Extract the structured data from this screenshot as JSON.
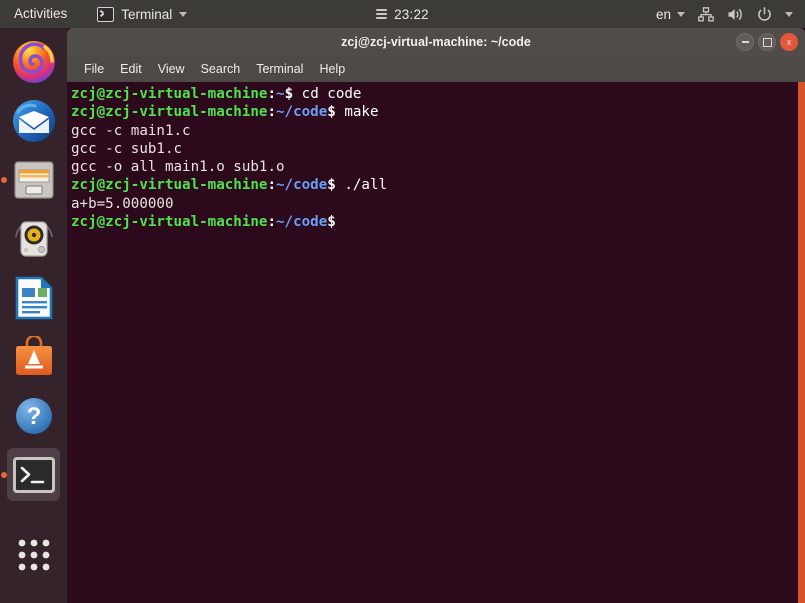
{
  "topbar": {
    "activities": "Activities",
    "app_name": "Terminal",
    "app_icon": "terminal-icon",
    "clock": "23:22",
    "clock_icon": "calendar-menu-icon",
    "language": "en",
    "tray_icons": [
      "network-wired-icon",
      "volume-icon",
      "power-icon",
      "chevron-down-icon"
    ]
  },
  "dock": {
    "items": [
      {
        "name": "firefox",
        "label": "Firefox",
        "running": false
      },
      {
        "name": "thunderbird",
        "label": "Thunderbird Mail",
        "running": false
      },
      {
        "name": "files",
        "label": "Files",
        "running": true
      },
      {
        "name": "rhythmbox",
        "label": "Rhythmbox",
        "running": false
      },
      {
        "name": "libreoffice-writer",
        "label": "LibreOffice Writer",
        "running": false
      },
      {
        "name": "ubuntu-software",
        "label": "Ubuntu Software",
        "running": false
      },
      {
        "name": "help",
        "label": "Help",
        "running": false
      },
      {
        "name": "terminal",
        "label": "Terminal",
        "running": true,
        "active": true
      },
      {
        "name": "show-applications",
        "label": "Show Applications",
        "running": false
      }
    ]
  },
  "window": {
    "title": "zcj@zcj-virtual-machine: ~/code",
    "controls": {
      "minimize": "–",
      "maximize": "□",
      "close": "x"
    },
    "menu": [
      "File",
      "Edit",
      "View",
      "Search",
      "Terminal",
      "Help"
    ]
  },
  "terminal": {
    "user_host": "zcj@zcj-virtual-machine",
    "lines": [
      {
        "type": "prompt",
        "user": "zcj@zcj-virtual-machine",
        "sep": ":",
        "path": "~",
        "dollar": "$",
        "command": " cd code"
      },
      {
        "type": "prompt",
        "user": "zcj@zcj-virtual-machine",
        "sep": ":",
        "path": "~/code",
        "dollar": "$",
        "command": " make"
      },
      {
        "type": "output",
        "text": "gcc -c main1.c"
      },
      {
        "type": "output",
        "text": "gcc -c sub1.c"
      },
      {
        "type": "output",
        "text": "gcc -o all main1.o sub1.o"
      },
      {
        "type": "prompt",
        "user": "zcj@zcj-virtual-machine",
        "sep": ":",
        "path": "~/code",
        "dollar": "$",
        "command": " ./all"
      },
      {
        "type": "output",
        "text": "a+b=5.000000"
      },
      {
        "type": "prompt",
        "user": "zcj@zcj-virtual-machine",
        "sep": ":",
        "path": "~/code",
        "dollar": "$",
        "command": ""
      }
    ]
  },
  "colors": {
    "topbar_bg": "#3c3b37",
    "dock_bg": "#34232b",
    "titlebar_bg": "#504c48",
    "menubar_bg": "#4d4945",
    "terminal_bg": "#2c0a1c",
    "prompt_user": "#4ee24e",
    "prompt_path": "#6a9ffa",
    "scrollbar": "#d8532a",
    "accent_orange": "#e8643c",
    "close_button": "#e2563a"
  }
}
